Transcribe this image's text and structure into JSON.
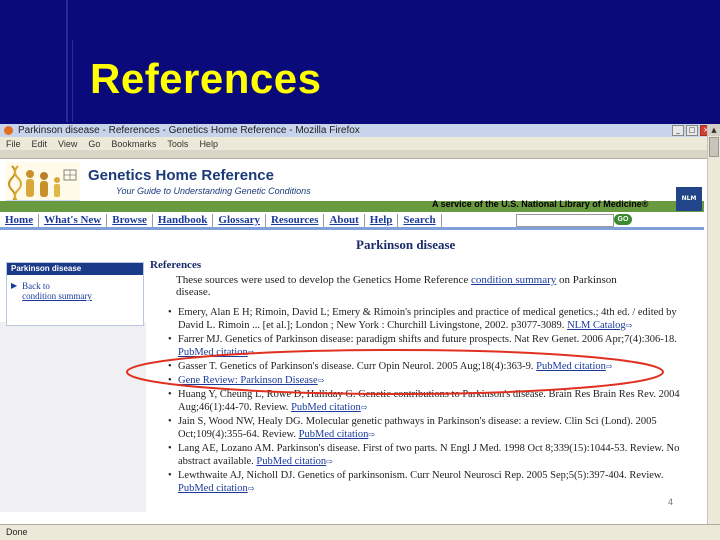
{
  "slide": {
    "title": "References"
  },
  "browser": {
    "window_title": "Parkinson disease - References - Genetics Home Reference - Mozilla Firefox",
    "menu": [
      "File",
      "Edit",
      "View",
      "Go",
      "Bookmarks",
      "Tools",
      "Help"
    ],
    "status": "Done"
  },
  "site": {
    "name": "Genetics Home Reference",
    "tagline": "Your Guide to Understanding Genetic Conditions",
    "service_note": "A service of the U.S. National Library of Medicine®",
    "nlm_badge": "NLM",
    "nav": [
      "Home",
      "What's New",
      "Browse",
      "Handbook",
      "Glossary",
      "Resources",
      "About",
      "Help",
      "Search"
    ],
    "go_label": "GO",
    "page_heading": "Parkinson disease"
  },
  "sidebar": {
    "heading": "Parkinson disease",
    "back_line1": "Back to",
    "back_line2": "condition summary"
  },
  "references": {
    "heading": "References",
    "intro_pre": "These sources were used to develop the Genetics Home Reference ",
    "intro_link": "condition summary",
    "intro_post": " on Parkinson disease.",
    "items": [
      {
        "text": "Emery, Alan E H; Rimoin, David L; Emery & Rimoin's principles and practice of medical genetics.; 4th ed. / edited by David L. Rimoin ... [et al.]; London ; New York : Churchill Livingstone, 2002. p3077-3089.",
        "link": "NLM Catalog"
      },
      {
        "text": "Farrer MJ. Genetics of Parkinson disease: paradigm shifts and future prospects. Nat Rev Genet. 2006 Apr;7(4):306-18.",
        "link": "PubMed citation"
      },
      {
        "text": "Gasser T. Genetics of Parkinson's disease. Curr Opin Neurol. 2005 Aug;18(4):363-9.",
        "link": "PubMed citation"
      },
      {
        "text": "",
        "link": "Gene Review: Parkinson Disease"
      },
      {
        "text": "Huang Y, Cheung L, Rowe D, Halliday G. Genetic contributions to Parkinson's disease. Brain Res Brain Res Rev. 2004 Aug;46(1):44-70. Review.",
        "link": "PubMed citation"
      },
      {
        "text": "Jain S, Wood NW, Healy DG. Molecular genetic pathways in Parkinson's disease: a review. Clin Sci (Lond). 2005 Oct;109(4):355-64. Review.",
        "link": "PubMed citation"
      },
      {
        "text": "Lang AE, Lozano AM. Parkinson's disease. First of two parts. N Engl J Med. 1998 Oct 8;339(15):1044-53. Review. No abstract available.",
        "link": "PubMed citation"
      },
      {
        "text": "Lewthwaite AJ, Nicholl DJ. Genetics of parkinsonism. Curr Neurol Neurosci Rep. 2005 Sep;5(5):397-404. Review.",
        "link": "PubMed citation"
      }
    ]
  },
  "colors": {
    "slide_background": "#0a0a7a",
    "title": "#ffff00",
    "annotation": "#e03020",
    "link": "#1a3a9a"
  }
}
